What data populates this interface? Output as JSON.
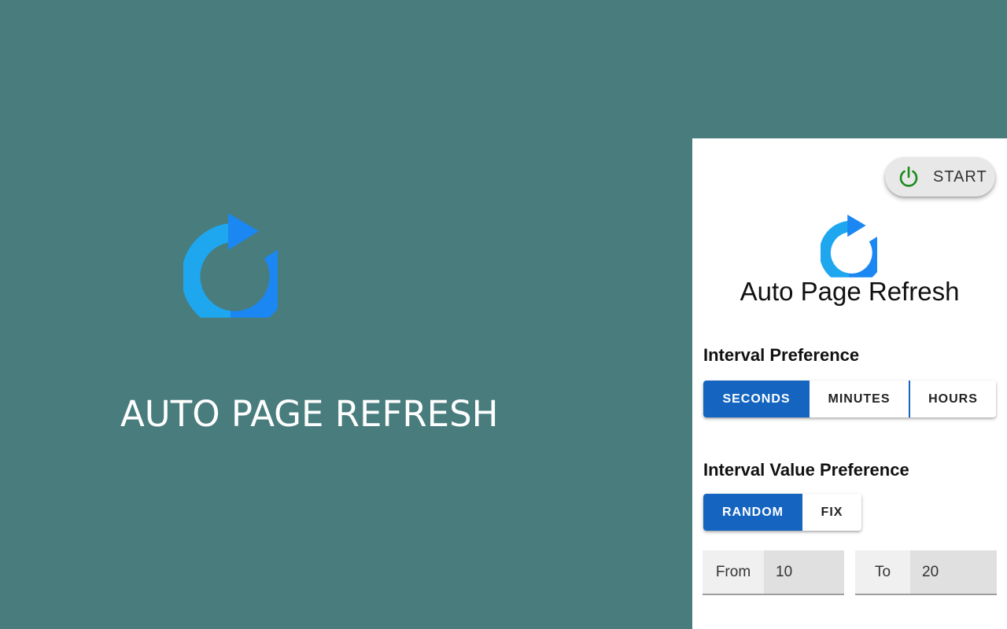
{
  "hero": {
    "title": "AUTO PAGE REFRESH",
    "logo_icon": "refresh-icon"
  },
  "popup": {
    "start_button": {
      "label": "START",
      "icon": "power-icon",
      "icon_color": "#1a8a1a"
    },
    "logo_icon": "refresh-icon",
    "title": "Auto Page Refresh",
    "interval_preference": {
      "heading": "Interval Preference",
      "options": [
        "SECONDS",
        "MINUTES",
        "HOURS"
      ],
      "selected": "SECONDS"
    },
    "interval_value_preference": {
      "heading": "Interval Value Preference",
      "options": [
        "RANDOM",
        "FIX"
      ],
      "selected": "RANDOM"
    },
    "range": {
      "from_label": "From",
      "from_value": "10",
      "to_label": "To",
      "to_value": "20"
    }
  },
  "colors": {
    "background": "#487c7d",
    "accent": "#1565c0",
    "logo_light": "#1ea7ef",
    "logo_dark": "#1b87f2"
  }
}
